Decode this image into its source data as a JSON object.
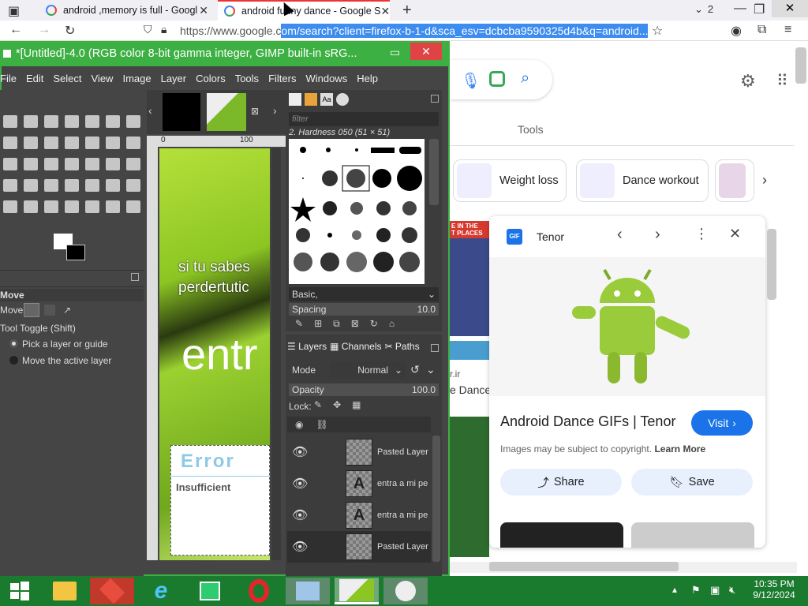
{
  "browser": {
    "tabs": [
      {
        "title": "android ,memory is full - Googl"
      },
      {
        "title": "android funny dance - Google S"
      }
    ],
    "tab_count": "2",
    "url_prefix": "https://www.google.c",
    "url_selected": "om/search?client=firefox-b-1-d&sca_esv=dcbcba9590325d4b&q=android..."
  },
  "gimp": {
    "title": "*[Untitled]-4.0 (RGB color 8-bit gamma integer, GIMP built-in sRG...",
    "menu": [
      "File",
      "Edit",
      "Select",
      "View",
      "Image",
      "Layer",
      "Colors",
      "Tools",
      "Filters",
      "Windows",
      "Help"
    ],
    "tool_options": {
      "heading": "Move",
      "move_label": "Move:",
      "toggle_label": "Tool Toggle  (Shift)",
      "option1": "Pick a layer or guide",
      "option2": "Move the active layer"
    },
    "ruler": {
      "r0": "0",
      "r100": "100"
    },
    "canvas_text": {
      "line1": "si tu sabes",
      "line2": "perdertutic",
      "big": "entr",
      "error": "Error",
      "insufficient": "Insufficient"
    },
    "brushes": {
      "filter_placeholder": "filter",
      "selected": "2. Hardness 050 (51 × 51)",
      "preset": "Basic,",
      "spacing_label": "Spacing",
      "spacing_value": "10.0"
    },
    "layers_panel": {
      "tabs": [
        "Layers",
        "Channels",
        "Paths"
      ],
      "mode_label": "Mode",
      "mode_value": "Normal",
      "opacity_label": "Opacity",
      "opacity_value": "100.0",
      "lock_label": "Lock:",
      "layers": [
        {
          "name": "Pasted Layer",
          "thumb": ""
        },
        {
          "name": "entra a mi pe",
          "thumb": "A"
        },
        {
          "name": "entra a mi pe",
          "thumb": "A"
        },
        {
          "name": "Pasted Layer",
          "thumb": ""
        }
      ]
    }
  },
  "google": {
    "tools_label": "Tools",
    "chips": [
      {
        "label": "Weight loss"
      },
      {
        "label": "Dance workout"
      }
    ],
    "left_result": {
      "banner": "E IN THE\nT PLACES",
      "site": "r.ir",
      "title": "e Dance"
    },
    "tenor": {
      "source": "Tenor",
      "title": "Android Dance GIFs | Tenor",
      "visit": "Visit",
      "copyright": "Images may be subject to copyright.",
      "learn_more": "Learn More",
      "share": "Share",
      "save": "Save"
    }
  },
  "taskbar": {
    "time": "10:35 PM",
    "date": "9/12/2024"
  },
  "colors": {
    "gimp_green": "#3cb043",
    "taskbar_green": "#1a7a2e",
    "google_blue": "#1a73e8",
    "selection_blue": "#3d8cf0"
  }
}
